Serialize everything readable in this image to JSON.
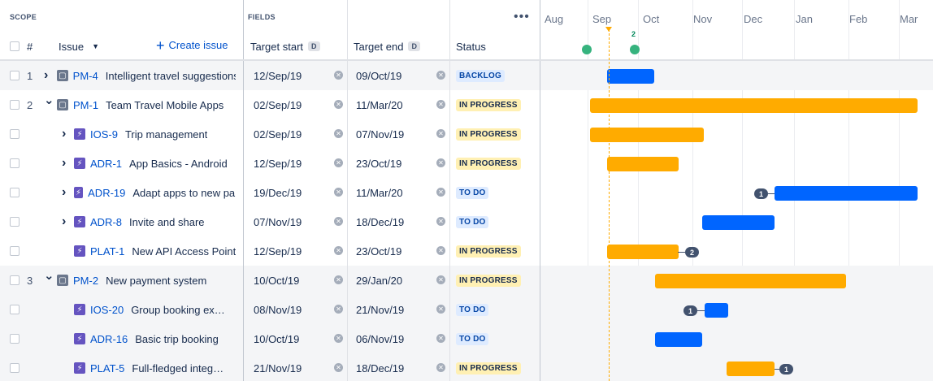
{
  "scope_label": "SCOPE",
  "fields_label": "FIELDS",
  "columns": {
    "hash": "#",
    "issue": "Issue",
    "create_issue": "Create issue",
    "target_start": "Target start",
    "target_end": "Target end",
    "date_badge": "D",
    "status": "Status"
  },
  "months": [
    "Aug",
    "Sep",
    "Oct",
    "Nov",
    "Dec",
    "Jan",
    "Feb",
    "Mar"
  ],
  "release_group_count": "2",
  "rows": [
    {
      "num": "1",
      "key": "PM-4",
      "summary": "Intelligent travel suggestions",
      "start": "12/Sep/19",
      "end": "09/Oct/19",
      "status": "BACKLOG",
      "dep": ""
    },
    {
      "num": "2",
      "key": "PM-1",
      "summary": "Team Travel Mobile Apps",
      "start": "02/Sep/19",
      "end": "11/Mar/20",
      "status": "IN PROGRESS",
      "dep": ""
    },
    {
      "num": "",
      "key": "IOS-9",
      "summary": "Trip management",
      "start": "02/Sep/19",
      "end": "07/Nov/19",
      "status": "IN PROGRESS",
      "dep": ""
    },
    {
      "num": "",
      "key": "ADR-1",
      "summary": "App Basics - Android",
      "start": "12/Sep/19",
      "end": "23/Oct/19",
      "status": "IN PROGRESS",
      "dep": ""
    },
    {
      "num": "",
      "key": "ADR-19",
      "summary": "Adapt apps to new partners",
      "start": "19/Dec/19",
      "end": "11/Mar/20",
      "status": "TO DO",
      "dep": "1"
    },
    {
      "num": "",
      "key": "ADR-8",
      "summary": "Invite and share",
      "start": "07/Nov/19",
      "end": "18/Dec/19",
      "status": "TO DO",
      "dep": ""
    },
    {
      "num": "",
      "key": "PLAT-1",
      "summary": "New API Access Point",
      "start": "12/Sep/19",
      "end": "23/Oct/19",
      "status": "IN PROGRESS",
      "dep": "2"
    },
    {
      "num": "3",
      "key": "PM-2",
      "summary": "New payment system",
      "start": "10/Oct/19",
      "end": "29/Jan/20",
      "status": "IN PROGRESS",
      "dep": ""
    },
    {
      "num": "",
      "key": "IOS-20",
      "summary": "Group booking ex…",
      "start": "08/Nov/19",
      "end": "21/Nov/19",
      "status": "TO DO",
      "dep": "1"
    },
    {
      "num": "",
      "key": "ADR-16",
      "summary": "Basic trip booking",
      "start": "10/Oct/19",
      "end": "06/Nov/19",
      "status": "TO DO",
      "dep": ""
    },
    {
      "num": "",
      "key": "PLAT-5",
      "summary": "Full-fledged integ…",
      "start": "21/Nov/19",
      "end": "18/Dec/19",
      "status": "IN PROGRESS",
      "dep": "1"
    }
  ],
  "colors": {
    "blue_bar": "#0065ff",
    "yellow_bar": "#ffab00",
    "release_marker": "#36b37e",
    "link": "#0052cc"
  }
}
